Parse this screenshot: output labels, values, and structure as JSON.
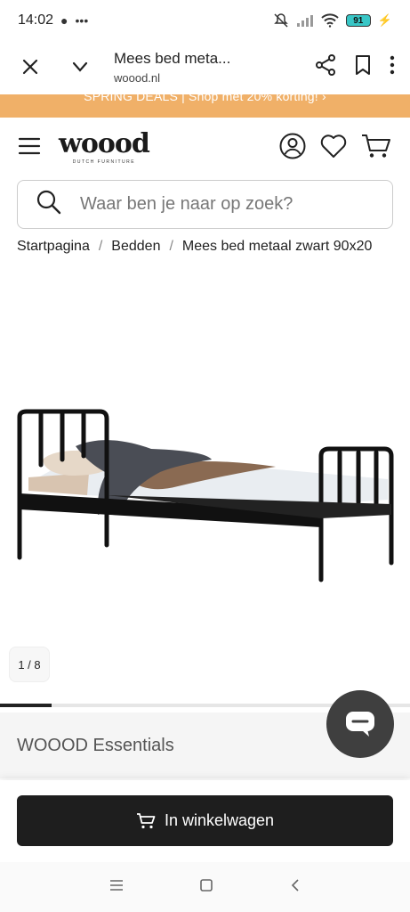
{
  "status": {
    "time": "14:02",
    "battery": "91"
  },
  "browser": {
    "page_title": "Mees bed meta...",
    "host": "woood.nl"
  },
  "promo": {
    "text": "SPRING DEALS | Shop met 20% korting! ›"
  },
  "brand": {
    "logo_text": "woood",
    "logo_sub": "DUTCH FURNITURE"
  },
  "search": {
    "placeholder": "Waar ben je naar op zoek?"
  },
  "breadcrumb": {
    "items": [
      "Startpagina",
      "Bedden",
      "Mees bed metaal zwart 90x20"
    ],
    "separator": "/"
  },
  "gallery": {
    "counter": "1 / 8",
    "progress": 0.125
  },
  "product": {
    "brand": "WOOOD Essentials"
  },
  "cart": {
    "label": "In winkelwagen"
  },
  "colors": {
    "accent": "#f0b068",
    "button": "#1e1e1e",
    "chat": "#3f3f3f"
  }
}
